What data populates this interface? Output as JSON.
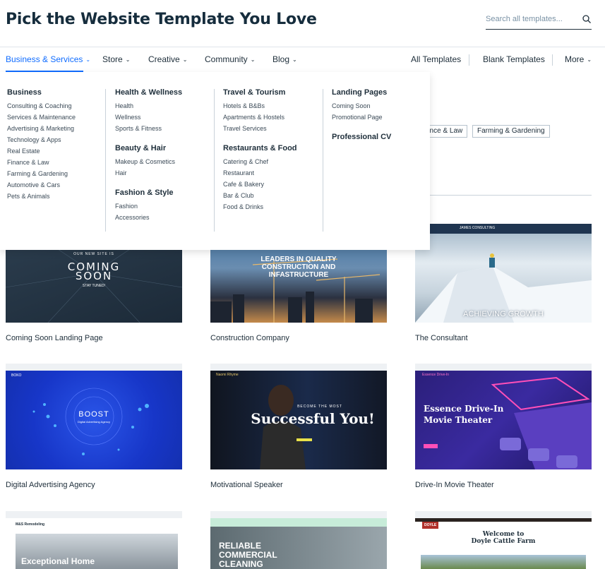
{
  "header": {
    "title": "Pick the Website Template You Love",
    "search_placeholder": "Search all templates..."
  },
  "nav": {
    "items": [
      {
        "label": "Business & Services",
        "active": true
      },
      {
        "label": "Store"
      },
      {
        "label": "Creative"
      },
      {
        "label": "Community"
      },
      {
        "label": "Blog"
      }
    ],
    "right": {
      "all_templates": "All Templates",
      "blank_templates": "Blank Templates",
      "more": "More"
    }
  },
  "mega_menu": {
    "columns": [
      {
        "groups": [
          {
            "heading": "Business",
            "links": [
              "Consulting & Coaching",
              "Services & Maintenance",
              "Advertising & Marketing",
              "Technology & Apps",
              "Real Estate",
              "Finance & Law",
              "Farming & Gardening",
              "Automotive & Cars",
              "Pets & Animals"
            ]
          }
        ]
      },
      {
        "groups": [
          {
            "heading": "Health & Wellness",
            "links": [
              "Health",
              "Wellness",
              "Sports & Fitness"
            ]
          },
          {
            "heading": "Beauty & Hair",
            "links": [
              "Makeup & Cosmetics",
              "Hair"
            ]
          },
          {
            "heading": "Fashion & Style",
            "links": [
              "Fashion",
              "Accessories"
            ]
          }
        ]
      },
      {
        "groups": [
          {
            "heading": "Travel & Tourism",
            "links": [
              "Hotels & B&Bs",
              "Apartments & Hostels",
              "Travel Services"
            ]
          },
          {
            "heading": "Restaurants & Food",
            "links": [
              "Catering & Chef",
              "Restaurant",
              "Cafe & Bakery",
              "Bar & Club",
              "Food & Drinks"
            ]
          }
        ]
      },
      {
        "groups": [
          {
            "heading": "Landing Pages",
            "links": [
              "Coming Soon",
              "Promotional Page"
            ]
          },
          {
            "heading": "Professional CV",
            "links": []
          }
        ]
      }
    ]
  },
  "behind_chips": [
    "ance & Law",
    "Farming & Gardening"
  ],
  "templates": [
    {
      "name": "Coming Soon Landing Page",
      "overlay": {
        "line1": "OUR NEW SITE IS",
        "line2": "COMING",
        "line3": "SOON",
        "line4": "STAY TUNED!"
      }
    },
    {
      "name": "Construction Company",
      "overlay": {
        "line1": "LEADERS IN QUALITY",
        "line2": "CONSTRUCTION AND",
        "line3": "INFASTRUCTURE"
      }
    },
    {
      "name": "The Consultant",
      "overlay": {
        "brand": "JAMES CONSULTING",
        "line1": "ACHIEVING GROWTH"
      }
    },
    {
      "name": "Digital Advertising Agency",
      "overlay": {
        "brand": "BOKO",
        "line1": "BOOST",
        "line2": "Digital Advertising Agency"
      }
    },
    {
      "name": "Motivational Speaker",
      "overlay": {
        "brand": "Naomi Rhyme",
        "line1": "BECOME THE MOST",
        "line2": "Successful You!"
      }
    },
    {
      "name": "Drive-In Movie Theater",
      "overlay": {
        "brand": "Essence Drive-In",
        "line1": "Essence Drive-In",
        "line2": "Movie Theater"
      }
    },
    {
      "name": "",
      "overlay": {
        "brand": "M&S Remodeling",
        "line1": "Exceptional Home"
      }
    },
    {
      "name": "",
      "overlay": {
        "line1": "RELIABLE",
        "line2": "COMMERCIAL",
        "line3": "CLEANING"
      }
    },
    {
      "name": "",
      "overlay": {
        "brand": "DOYLE",
        "line1": "Welcome to",
        "line2": "Doyle Cattle Farm"
      }
    }
  ],
  "colors": {
    "accent": "#116dff",
    "text": "#20303c"
  }
}
